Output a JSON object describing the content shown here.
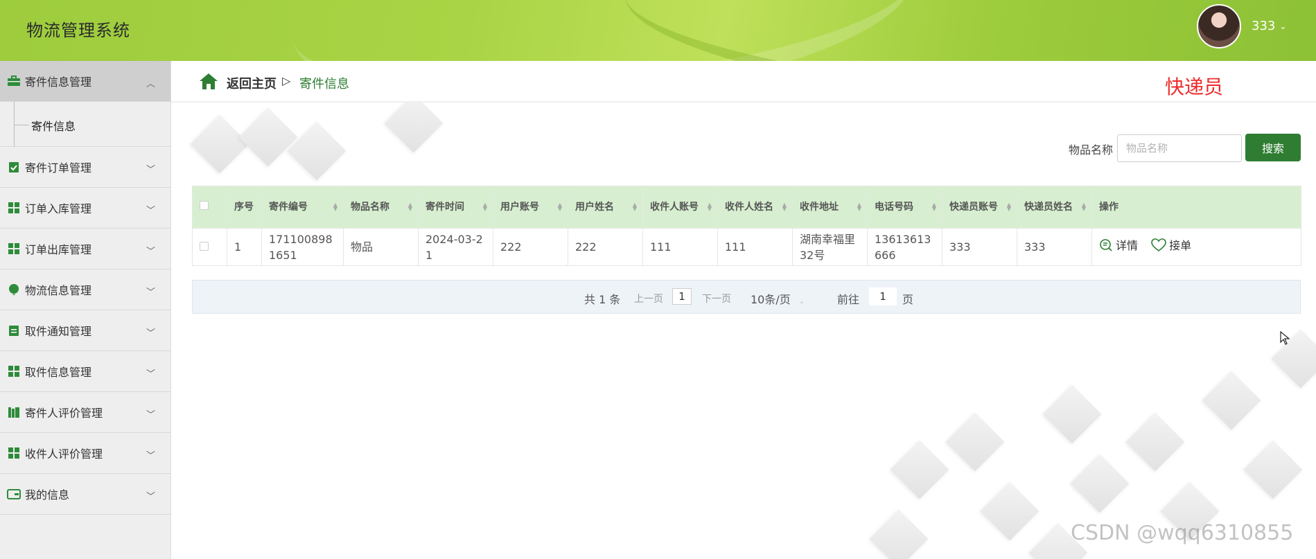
{
  "header": {
    "title": "物流管理系统",
    "username": "333"
  },
  "sidebar": {
    "items": [
      {
        "label": "寄件信息管理",
        "icon": "briefcase-icon",
        "expanded": true
      },
      {
        "label": "寄件订单管理",
        "icon": "clipboard-check-icon"
      },
      {
        "label": "订单入库管理",
        "icon": "grid-icon"
      },
      {
        "label": "订单出库管理",
        "icon": "grid-icon"
      },
      {
        "label": "物流信息管理",
        "icon": "balloon-icon"
      },
      {
        "label": "取件通知管理",
        "icon": "clipboard-icon"
      },
      {
        "label": "取件信息管理",
        "icon": "grid-icon"
      },
      {
        "label": "寄件人评价管理",
        "icon": "books-icon"
      },
      {
        "label": "收件人评价管理",
        "icon": "grid-icon"
      },
      {
        "label": "我的信息",
        "icon": "wallet-icon"
      }
    ],
    "subitems": [
      {
        "label": "寄件信息"
      }
    ]
  },
  "breadcrumb": {
    "home": "返回主页",
    "separator": "▷",
    "current": "寄件信息"
  },
  "role": "快递员",
  "search": {
    "label": "物品名称",
    "placeholder": "物品名称",
    "button": "搜索"
  },
  "table": {
    "columns": [
      "序号",
      "寄件编号",
      "物品名称",
      "寄件时间",
      "用户账号",
      "用户姓名",
      "收件人账号",
      "收件人姓名",
      "收件地址",
      "电话号码",
      "快递员账号",
      "快递员姓名",
      "操作"
    ],
    "rows": [
      {
        "index": "1",
        "code": "1711008981651",
        "item": "物品",
        "time": "2024-03-21",
        "user_account": "222",
        "user_name": "222",
        "recv_account": "111",
        "recv_name": "111",
        "address": "湖南幸福里32号",
        "phone": "13613613666",
        "courier_account": "333",
        "courier_name": "333",
        "actions": {
          "detail": "详情",
          "accept": "接单"
        }
      }
    ]
  },
  "pagination": {
    "total": "共 1 条",
    "prev": "上一页",
    "page": "1",
    "next": "下一页",
    "page_size": "10条/页",
    "goto": "前往",
    "goto_value": "1",
    "page_unit": "页"
  },
  "watermark": "CSDN @wqq6310855",
  "colors": {
    "accent": "#2e7d32",
    "header_green": "#9dcc3c",
    "role_red": "#ef2b2b",
    "table_header": "#d7efd0"
  }
}
